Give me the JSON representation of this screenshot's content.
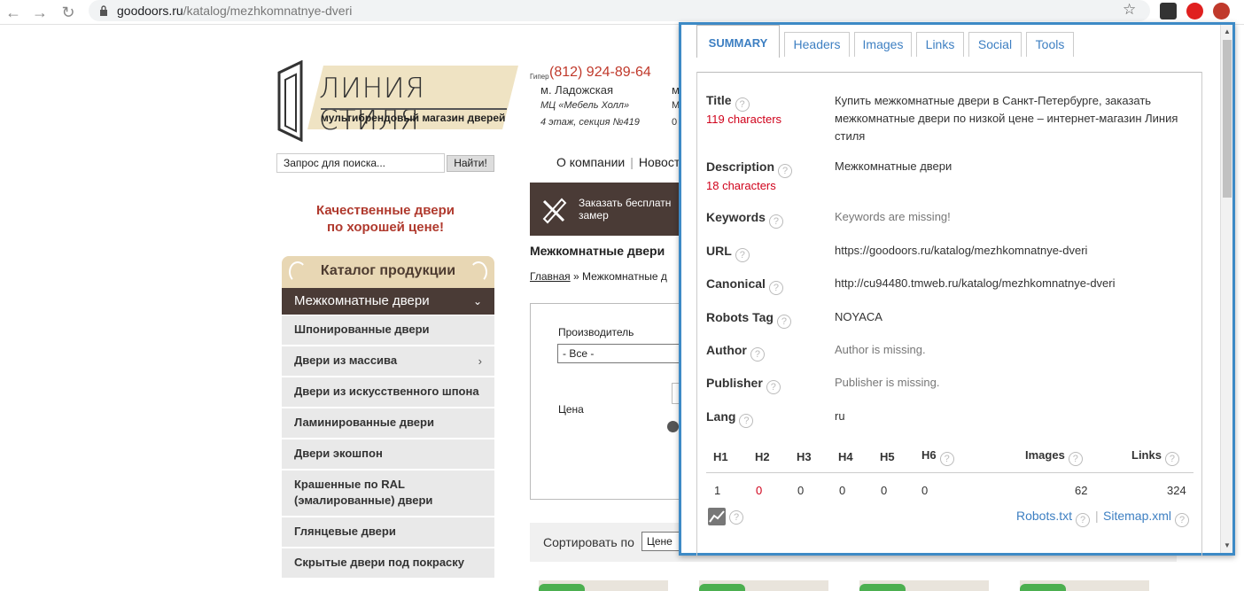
{
  "browser": {
    "url_domain": "goodoors.ru",
    "url_path": "/katalog/mezhkomnatnye-dveri"
  },
  "site": {
    "brand_name": "ЛИНИЯ СТИЛЯ",
    "brand_tagline": "мультибрендовый магазин дверей",
    "phone_label": "Гипер",
    "phone": "(812) 924-89-64",
    "metro": "м. Ладожская",
    "mall": "МЦ «Мебель Холл»",
    "floor": "4 этаж, секция №419",
    "metro2": "м",
    "metro2b": "М",
    "metro2c": "0",
    "search_placeholder": "Запрос для поиска...",
    "search_button": "Найти!",
    "topmenu": [
      "О компании",
      "Новост"
    ],
    "slogan_line1": "Качественные двери",
    "slogan_line2": "по хорошей цене!",
    "order_line1": "Заказать бесплатн",
    "order_line2": "замер",
    "page_heading": "Межкомнатные двери",
    "crumb_home": "Главная",
    "crumb_current": "» Межкомнатные д",
    "filter_manufacturer": "Производитель",
    "filter_select": "- Все -",
    "filter_price": "Цена",
    "sort_label": "Сортировать по",
    "sort_value": "Цене"
  },
  "catalog": {
    "title": "Каталог продукции",
    "active": "Межкомнатные двери",
    "items": [
      {
        "label": "Шпонированные двери",
        "has_sub": false
      },
      {
        "label": "Двери из массива",
        "has_sub": true
      },
      {
        "label": "Двери из искусственного шпона",
        "has_sub": false
      },
      {
        "label": "Ламинированные двери",
        "has_sub": false
      },
      {
        "label": "Двери экошпон",
        "has_sub": false
      },
      {
        "label": "Крашенные по RAL (эмалированные) двери",
        "has_sub": false
      },
      {
        "label": "Глянцевые двери",
        "has_sub": false
      },
      {
        "label": "Скрытые двери под покраску",
        "has_sub": false
      }
    ]
  },
  "seo": {
    "tabs": [
      "SUMMARY",
      "Headers",
      "Images",
      "Links",
      "Social",
      "Tools"
    ],
    "title_label": "Title",
    "title_count": "119 characters",
    "title_value": "Купить межкомнатные двери в Санкт-Петербурге, заказать межкомнатные двери по низкой цене – интернет-магазин Линия стиля",
    "description_label": "Description",
    "description_count": "18 characters",
    "description_value": "Межкомнатные двери",
    "keywords_label": "Keywords",
    "keywords_value": "Keywords are missing!",
    "url_label": "URL",
    "url_value": "https://goodoors.ru/katalog/mezhkomnatnye-dveri",
    "canonical_label": "Canonical",
    "canonical_value": "http://cu94480.tmweb.ru/katalog/mezhkomnatnye-dveri",
    "robots_label": "Robots Tag",
    "robots_value": "NOYACA",
    "author_label": "Author",
    "author_value": "Author is missing.",
    "publisher_label": "Publisher",
    "publisher_value": "Publisher is missing.",
    "lang_label": "Lang",
    "lang_value": "ru",
    "headers": [
      "H1",
      "H2",
      "H3",
      "H4",
      "H5",
      "H6"
    ],
    "header_counts": [
      "1",
      "0",
      "0",
      "0",
      "0",
      "0"
    ],
    "images_label": "Images",
    "images_count": "62",
    "links_label": "Links",
    "links_count": "324",
    "robots_link": "Robots.txt",
    "sitemap_link": "Sitemap.xml",
    "help_glyph": "?"
  }
}
